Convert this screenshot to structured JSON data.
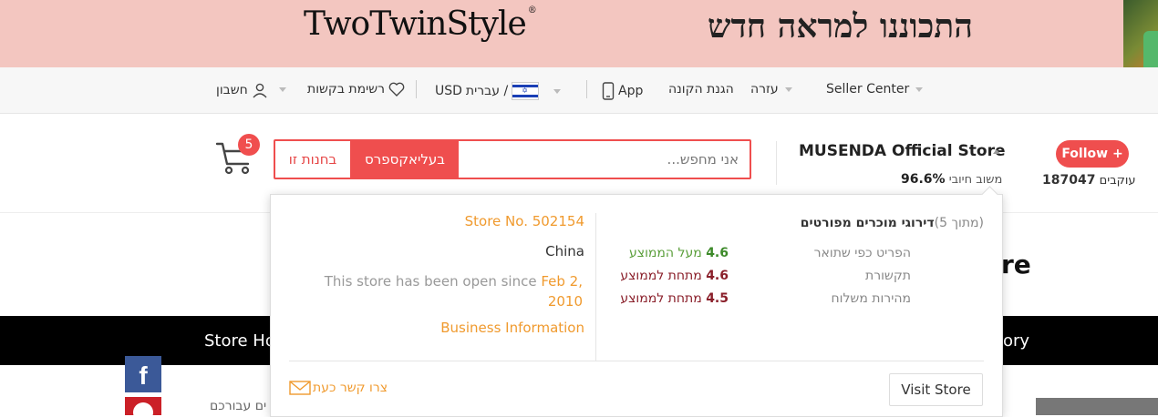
{
  "banner": {
    "brand": "TwoTwinStyle",
    "brand_mark": "®",
    "promo": "התכוננו למראה חדש"
  },
  "topbar": {
    "seller_center": "Seller Center",
    "help": "עזרה",
    "buyer_protection": "הגנת הקונה",
    "app": "App",
    "language": "עברית /",
    "currency": "USD",
    "wishlist": "רשימת בקשות",
    "account": "חשבון"
  },
  "cart": {
    "count": "5"
  },
  "search": {
    "placeholder": "אני מחפש...",
    "all_button": "בעליאקספרס",
    "store_button": "בחנות זו"
  },
  "store": {
    "name": "MUSENDA Official Store",
    "feedback_value": "96.6%",
    "feedback_label": "משוב חיובי",
    "follow_label": "Follow +",
    "followers_count": "187047",
    "followers_label": "עוקבים"
  },
  "popup": {
    "ratings_title": "דירוגי מוכרים מפורטים",
    "ratings_scale": "(מתוך 5)",
    "ratings": [
      {
        "label": "הפריט כפי שתואר",
        "score": "4.6",
        "comparison": "מעל הממוצע",
        "status": "above"
      },
      {
        "label": "תקשורת",
        "score": "4.6",
        "comparison": "מתחת לממוצע",
        "status": "below"
      },
      {
        "label": "מהירות משלוח",
        "score": "4.5",
        "comparison": "מתחת לממוצע",
        "status": "below"
      }
    ],
    "store_no": "Store No. 502154",
    "country": "China",
    "open_since_prefix": "This store has been open since",
    "open_since_date": "Feb 2, 2010",
    "business_info": "Business Information",
    "visit_store": "Visit Store",
    "contact_now": "צרו קשר כעת"
  },
  "background": {
    "store_title_fragment": "re",
    "nav_home_fragment": "Store Ho",
    "nav_right_fragment": "ory",
    "sidebar_text_fragment": "ים עבורכם"
  },
  "colors": {
    "accent": "#ef4e4e",
    "orange": "#f09a2e",
    "above_average": "#3d8a2a",
    "below_average": "#8a1f2a",
    "banner_bg": "#f3c6c0"
  }
}
